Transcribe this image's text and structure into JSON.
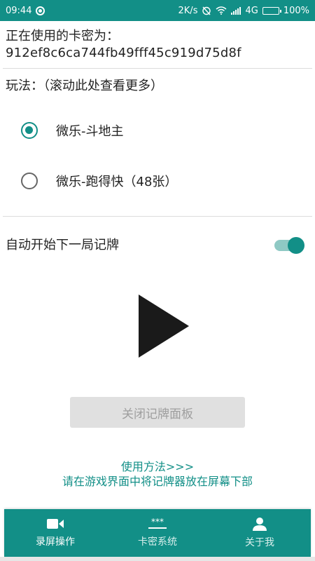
{
  "status_bar": {
    "time": "09:44",
    "speed": "2K/s",
    "network": "4G",
    "battery": "100%"
  },
  "card": {
    "label": "正在使用的卡密为：",
    "value": "912ef8c6ca744fb49fff45c919d75d8f"
  },
  "mode": {
    "title": "玩法：（滚动此处查看更多）",
    "options": [
      {
        "label": "微乐-斗地主",
        "checked": true
      },
      {
        "label": "微乐-跑得快（48张）",
        "checked": false
      }
    ]
  },
  "auto_record": {
    "label": "自动开始下一局记牌",
    "enabled": true
  },
  "close_panel_label": "关闭记牌面板",
  "usage": {
    "link": "使用方法>>>",
    "hint": "请在游戏界面中将记牌器放在屏幕下部"
  },
  "bottom_nav": [
    {
      "label": "录屏操作",
      "icon": "video-camera-icon",
      "active": true
    },
    {
      "label": "卡密系统",
      "icon": "password-icon",
      "active": false
    },
    {
      "label": "关于我",
      "icon": "person-icon",
      "active": false
    }
  ],
  "colors": {
    "accent": "#128f87",
    "accent_light": "#8fc9c4"
  }
}
